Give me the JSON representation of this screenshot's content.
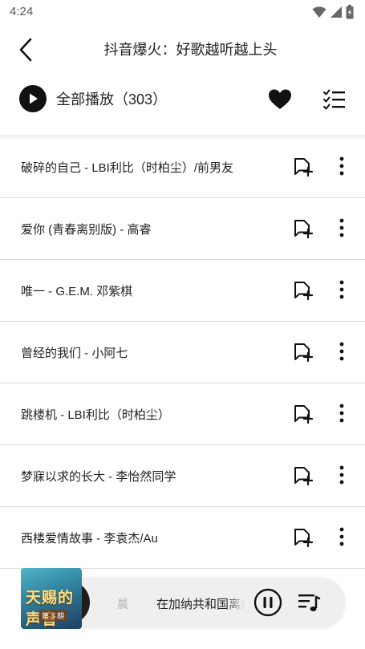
{
  "status_bar": {
    "time": "4:24"
  },
  "header": {
    "title": "抖音爆火：好歌越听越上头"
  },
  "toolbar": {
    "play_all_label": "全部播放（303）"
  },
  "songs": [
    {
      "title": "破碎的自己 - LBI利比（时柏尘）/前男友"
    },
    {
      "title": "爱你 (青春离别版) - 高睿"
    },
    {
      "title": "唯一 - G.E.M. 邓紫棋"
    },
    {
      "title": "曾经的我们 - 小阿七"
    },
    {
      "title": "跳楼机 - LBI利比（时柏尘）"
    },
    {
      "title": "梦寐以求的长大 - 李怡然同学"
    },
    {
      "title": "西楼爱情故事 - 李袁杰/Au"
    }
  ],
  "mini_player": {
    "artist": "晨",
    "title": "在加纳共和国离婚",
    "album_art_text": "天赐的声音",
    "album_art_sub": "第 3 期",
    "state": "playing"
  },
  "colors": {
    "accent": "#111111",
    "divider": "#dcdcdc",
    "background": "#ffffff"
  },
  "icons": {
    "back": "chevron-left-icon",
    "play": "play-icon",
    "favorite": "heart-icon",
    "multi_select": "checklist-icon",
    "add_to_playlist": "add-to-playlist-icon",
    "more": "more-vertical-icon",
    "pause": "pause-icon",
    "queue": "playlist-icon"
  }
}
